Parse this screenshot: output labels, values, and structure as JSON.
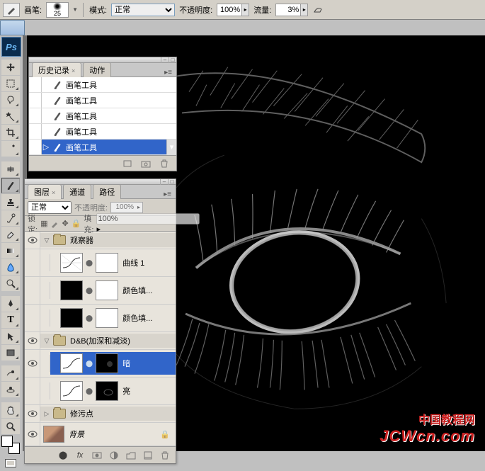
{
  "options": {
    "brush_label": "画笔:",
    "brush_size": "25",
    "mode_label": "模式:",
    "mode_value": "正常",
    "opacity_label": "不透明度:",
    "opacity_value": "100%",
    "flow_label": "流量:",
    "flow_value": "3%"
  },
  "app": {
    "ps": "Ps"
  },
  "history": {
    "tab1": "历史记录",
    "tab2": "动作",
    "items": [
      {
        "label": "画笔工具",
        "selected": false
      },
      {
        "label": "画笔工具",
        "selected": false
      },
      {
        "label": "画笔工具",
        "selected": false
      },
      {
        "label": "画笔工具",
        "selected": false
      },
      {
        "label": "画笔工具",
        "selected": true
      }
    ]
  },
  "layers": {
    "tab1": "图层",
    "tab2": "通道",
    "tab3": "路径",
    "blend": "正常",
    "opacity_label": "不透明度:",
    "opacity_value": "100%",
    "lock_label": "锁定:",
    "fill_label": "填充:",
    "fill_value": "100%",
    "groups": {
      "g1": "观察器",
      "g1_l1": "曲线 1",
      "g1_l2": "颜色填...",
      "g1_l3": "颜色填...",
      "g2": "D&B(加深和减淡)",
      "g2_l1": "暗",
      "g2_l2": "亮",
      "g3": "修污点",
      "bg": "背景"
    }
  },
  "watermark": {
    "zh": "中国教程网",
    "en": "JCWcn.com"
  }
}
